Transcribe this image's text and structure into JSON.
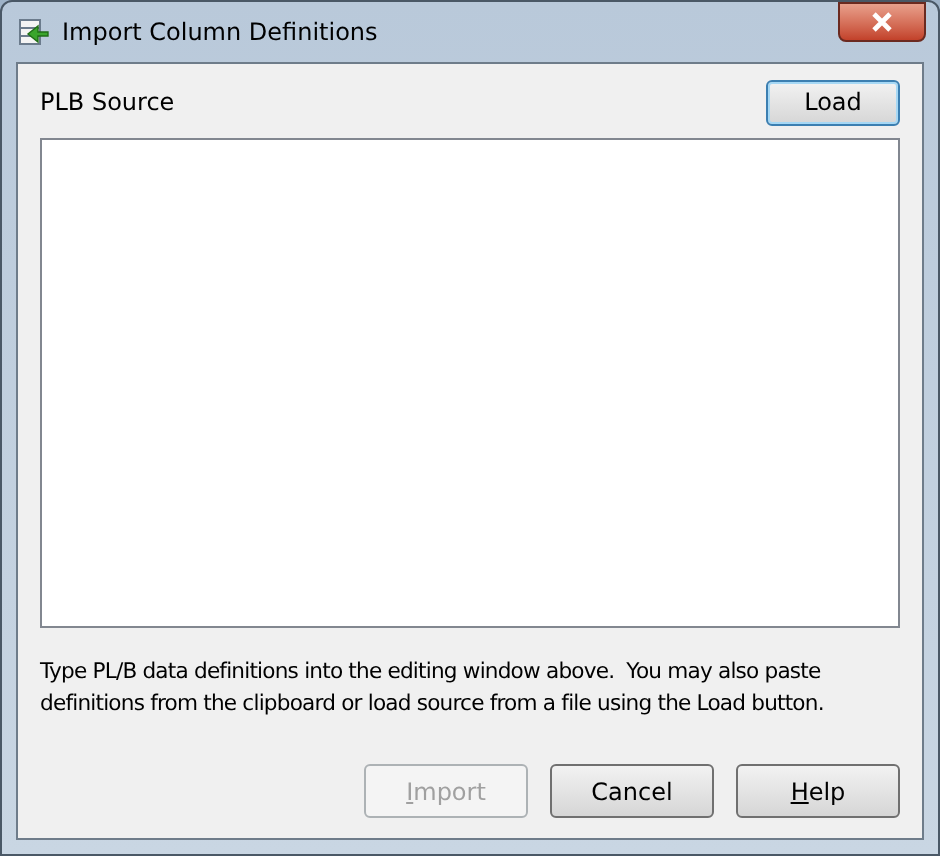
{
  "window": {
    "title": "Import Column Definitions"
  },
  "source": {
    "label": "PLB Source"
  },
  "load_button": {
    "label": "Load",
    "default": true
  },
  "hint": "Type PL/B data definitions into the editing window above.  You may also paste definitions from the clipboard or load source from a file using the Load button.",
  "buttons": [
    {
      "label": "Import",
      "disabled": true,
      "underline_first": true
    },
    {
      "label": "Cancel",
      "disabled": false,
      "underline_first": false
    },
    {
      "label": "Help",
      "disabled": false,
      "underline_first": true
    }
  ]
}
